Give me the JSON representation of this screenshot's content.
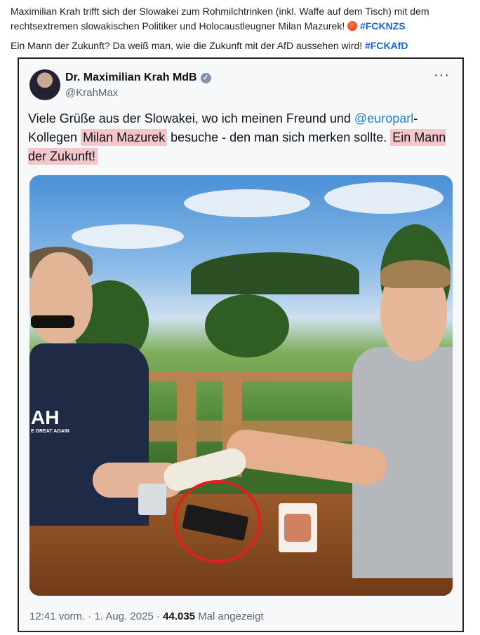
{
  "post": {
    "line1": "Maximilian Krah trifft sich der Slowakei zum Rohmilchtrinken (inkl. Waffe auf dem Tisch) mit dem rechtsextremen slowakischen Politiker und Holocaustleugner Milan Mazurek!",
    "hashtag1": "#FCKNZS",
    "line2": "Ein Mann der Zukunft? Da weiß man, wie die Zukunft mit der AfD aussehen wird!",
    "hashtag2": "#FCKAfD"
  },
  "tweet": {
    "author_name": "Dr. Maximilian Krah MdB",
    "handle": "@KrahMax",
    "more_label": "···",
    "text_part1": "Viele Grüße aus der Slowakei, wo ich meinen Freund und ",
    "mention": "@europarl",
    "text_part2": "-Kollegen ",
    "highlight1": "Milan Mazurek",
    "text_part3": " besuche - den man sich merken sollte. ",
    "highlight2": "Ein Mann der Zukunft!",
    "shirt_text_big": "AH",
    "shirt_text_small": "E GREAT AGAIN",
    "time": "12:41 vorm.",
    "separator": "·",
    "date": "1. Aug. 2025",
    "views": "44.035",
    "views_label": "Mal angezeigt"
  },
  "colors": {
    "hashtag": "#1a66d6",
    "highlight": "#f4c6c9",
    "mention": "#1d7fd0",
    "circle": "#e02020"
  },
  "icons": [
    "angry-face-icon",
    "verified-badge-icon",
    "more-options-icon"
  ]
}
